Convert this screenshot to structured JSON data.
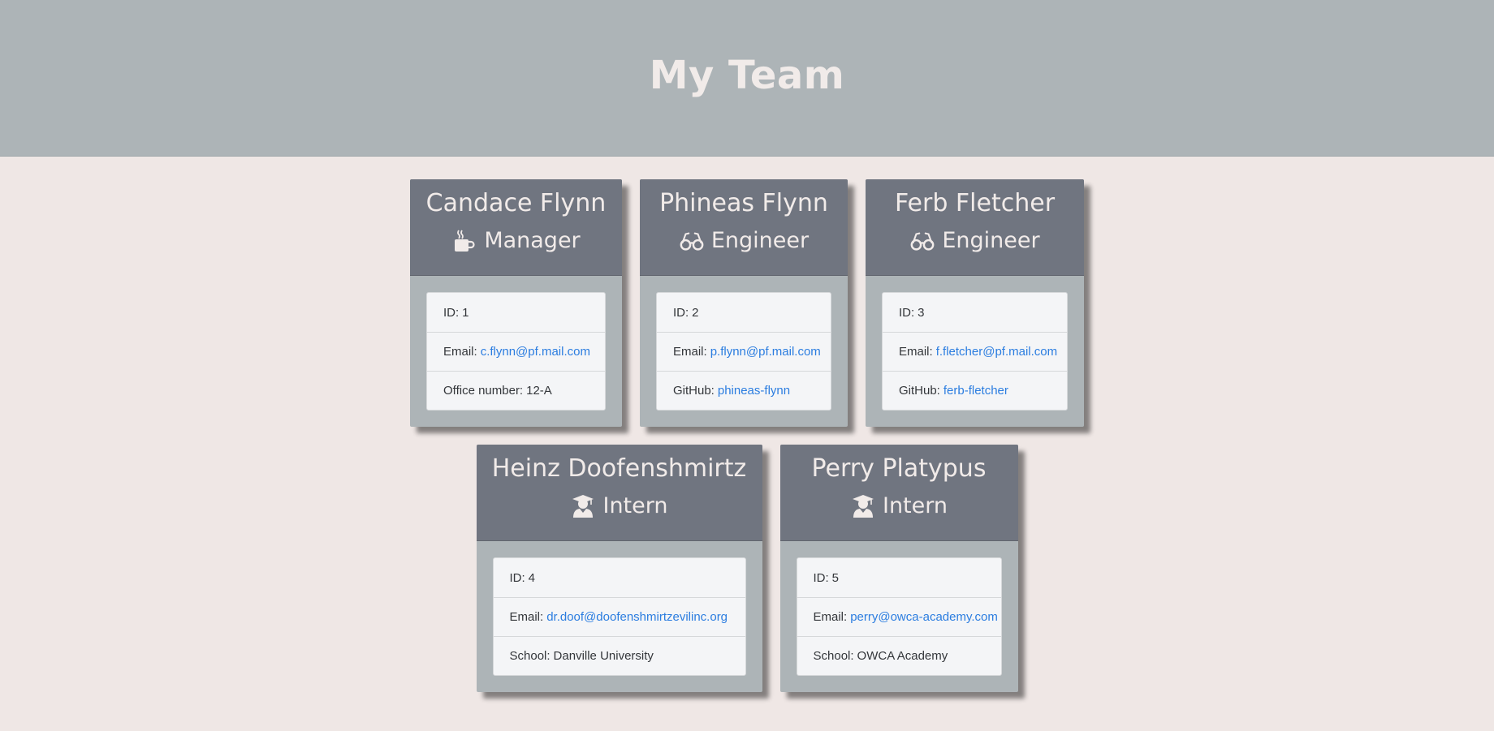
{
  "header": {
    "title": "My Team"
  },
  "team_rows": [
    [
      {
        "name": "Candace Flynn",
        "role": "Manager",
        "icon": "mug-icon",
        "id_label": "ID:",
        "id_value": "1",
        "email_label": "Email:",
        "email": "c.flynn@pf.mail.com",
        "extra_label": "Office number:",
        "extra_value": "12-A",
        "extra_is_link": false
      },
      {
        "name": "Phineas Flynn",
        "role": "Engineer",
        "icon": "glasses-icon",
        "id_label": "ID:",
        "id_value": "2",
        "email_label": "Email:",
        "email": "p.flynn@pf.mail.com",
        "extra_label": "GitHub:",
        "extra_value": "phineas-flynn",
        "extra_is_link": true
      },
      {
        "name": "Ferb Fletcher",
        "role": "Engineer",
        "icon": "glasses-icon",
        "id_label": "ID:",
        "id_value": "3",
        "email_label": "Email:",
        "email": "f.fletcher@pf.mail.com",
        "extra_label": "GitHub:",
        "extra_value": "ferb-fletcher",
        "extra_is_link": true
      }
    ],
    [
      {
        "name": "Heinz Doofenshmirtz",
        "role": "Intern",
        "icon": "graduate-icon",
        "id_label": "ID:",
        "id_value": "4",
        "email_label": "Email:",
        "email": "dr.doof@doofenshmirtzevilinc.org",
        "extra_label": "School:",
        "extra_value": "Danville University",
        "extra_is_link": false
      },
      {
        "name": "Perry Platypus",
        "role": "Intern",
        "icon": "graduate-icon",
        "id_label": "ID:",
        "id_value": "5",
        "email_label": "Email:",
        "email": "perry@owca-academy.com",
        "extra_label": "School:",
        "extra_value": "OWCA Academy",
        "extra_is_link": false
      }
    ]
  ],
  "colors": {
    "header_bg": "#adb4b7",
    "page_bg": "#efe7e5",
    "card_head_bg": "#707580",
    "card_body_bg": "#adb4b7",
    "link": "#2b7de0"
  }
}
